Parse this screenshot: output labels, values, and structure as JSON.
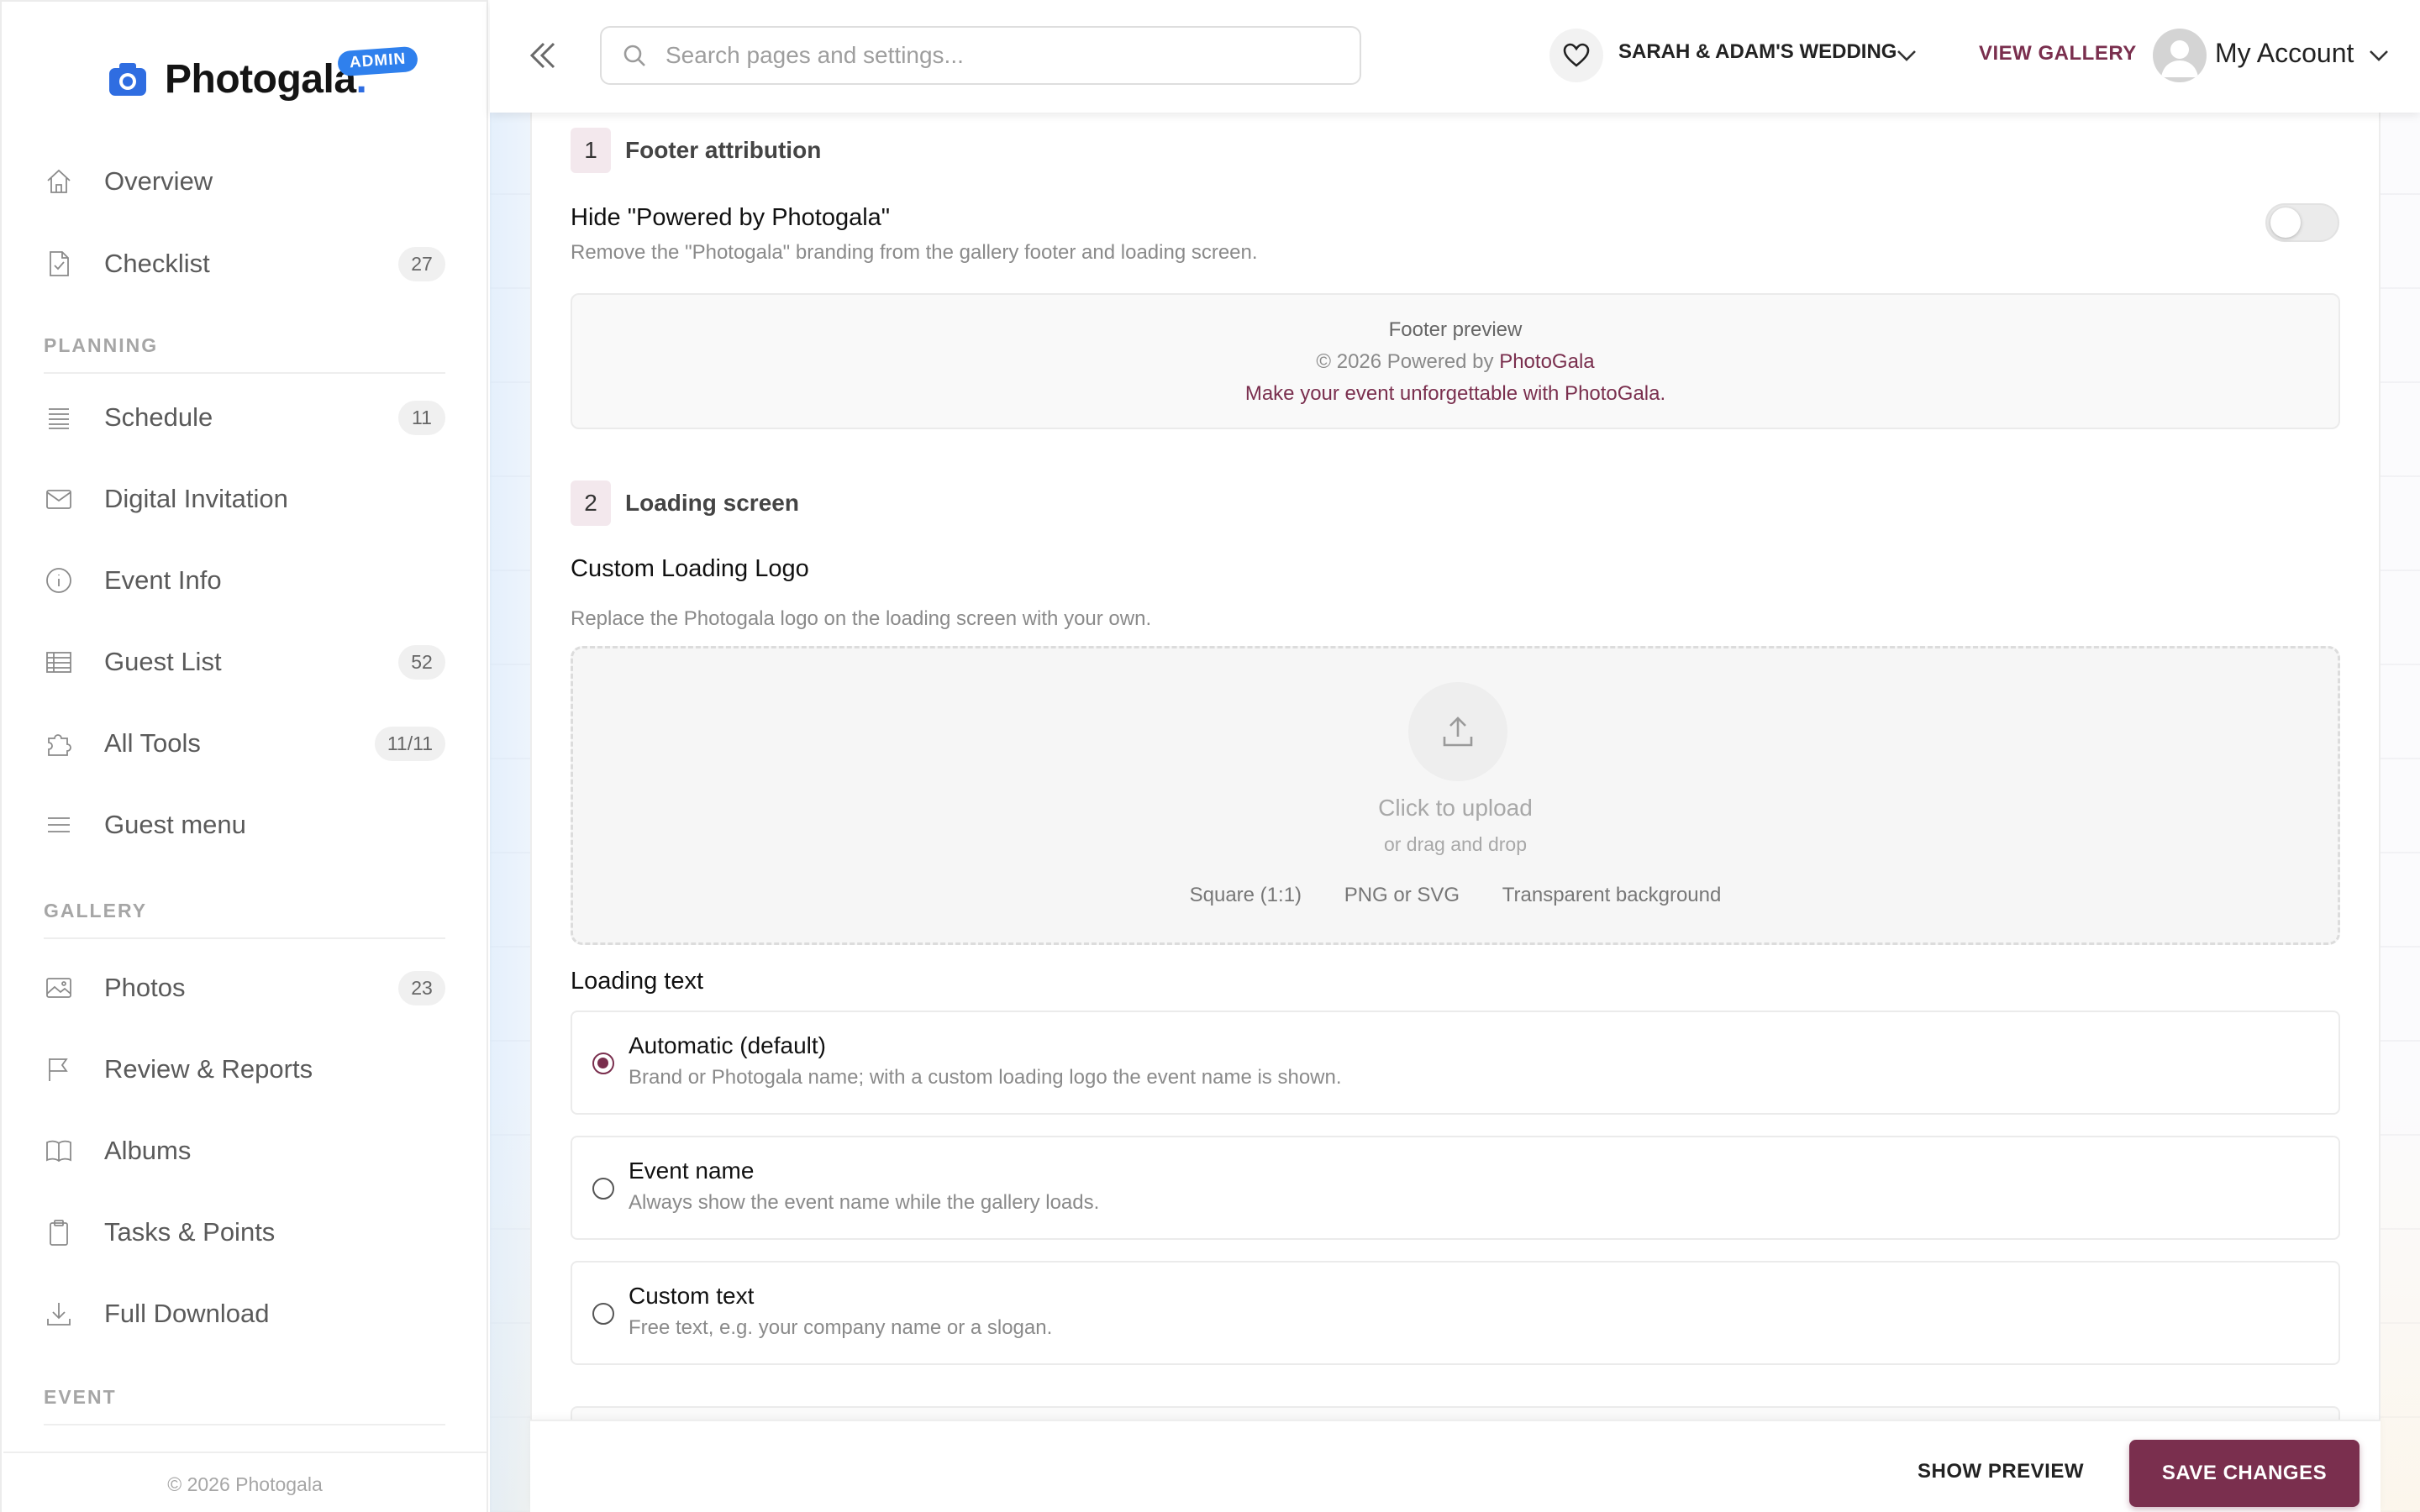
{
  "brand": {
    "name": "Photogala",
    "dot": ".",
    "badge": "ADMIN",
    "accent": "#2f6de1"
  },
  "sidebar": {
    "items_top": [
      {
        "label": "Overview",
        "icon": "home-icon",
        "count": ""
      },
      {
        "label": "Checklist",
        "icon": "checklist-icon",
        "count": "27"
      }
    ],
    "section_planning": "PLANNING",
    "items_planning": [
      {
        "label": "Schedule",
        "icon": "schedule-icon",
        "count": "11"
      },
      {
        "label": "Digital Invitation",
        "icon": "mail-icon",
        "count": ""
      },
      {
        "label": "Event Info",
        "icon": "info-icon",
        "count": ""
      },
      {
        "label": "Guest List",
        "icon": "table-icon",
        "count": "52"
      },
      {
        "label": "All Tools",
        "icon": "puzzle-icon",
        "count": "11/11"
      },
      {
        "label": "Guest menu",
        "icon": "menu-icon",
        "count": ""
      }
    ],
    "section_gallery": "GALLERY",
    "items_gallery": [
      {
        "label": "Photos",
        "icon": "image-icon",
        "count": "23"
      },
      {
        "label": "Review & Reports",
        "icon": "flag-icon",
        "count": ""
      },
      {
        "label": "Albums",
        "icon": "book-icon",
        "count": ""
      },
      {
        "label": "Tasks & Points",
        "icon": "clipboard-icon",
        "count": ""
      },
      {
        "label": "Full Download",
        "icon": "download-icon",
        "count": ""
      }
    ],
    "section_event": "EVENT",
    "footer": "© 2026 Photogala"
  },
  "header": {
    "search_placeholder": "Search pages and settings...",
    "event_name": "SARAH & ADAM'S WEDDING",
    "view_gallery": "VIEW GALLERY",
    "account": "My Account"
  },
  "sections": {
    "footer_attribution": {
      "number": "1",
      "title": "Footer attribution",
      "option_title": "Hide \"Powered by Photogala\"",
      "option_desc": "Remove the \"Photogala\" branding from the gallery footer and loading screen.",
      "toggle_on": false,
      "preview_label": "Footer preview",
      "preview_copy": "© 2026 Powered by",
      "preview_brand": "PhotoGala",
      "preview_tagline": "Make your event unforgettable with PhotoGala."
    },
    "loading_screen": {
      "number": "2",
      "title": "Loading screen",
      "logo_title": "Custom Loading Logo",
      "logo_desc": "Replace the Photogala logo on the loading screen with your own.",
      "upload_title": "Click to upload",
      "upload_sub": "or drag and drop",
      "hints": [
        "Square (1:1)",
        "PNG or SVG",
        "Transparent background"
      ],
      "loading_text_title": "Loading text",
      "options": [
        {
          "title": "Automatic (default)",
          "desc": "Brand or Photogala name; with a custom loading logo the event name is shown.",
          "checked": true
        },
        {
          "title": "Event name",
          "desc": "Always show the event name while the gallery loads.",
          "checked": false
        },
        {
          "title": "Custom text",
          "desc": "Free text, e.g. your company name or a slogan.",
          "checked": false
        }
      ]
    }
  },
  "actions": {
    "preview": "SHOW PREVIEW",
    "save": "SAVE CHANGES",
    "primary_color": "#7a2f4e"
  }
}
